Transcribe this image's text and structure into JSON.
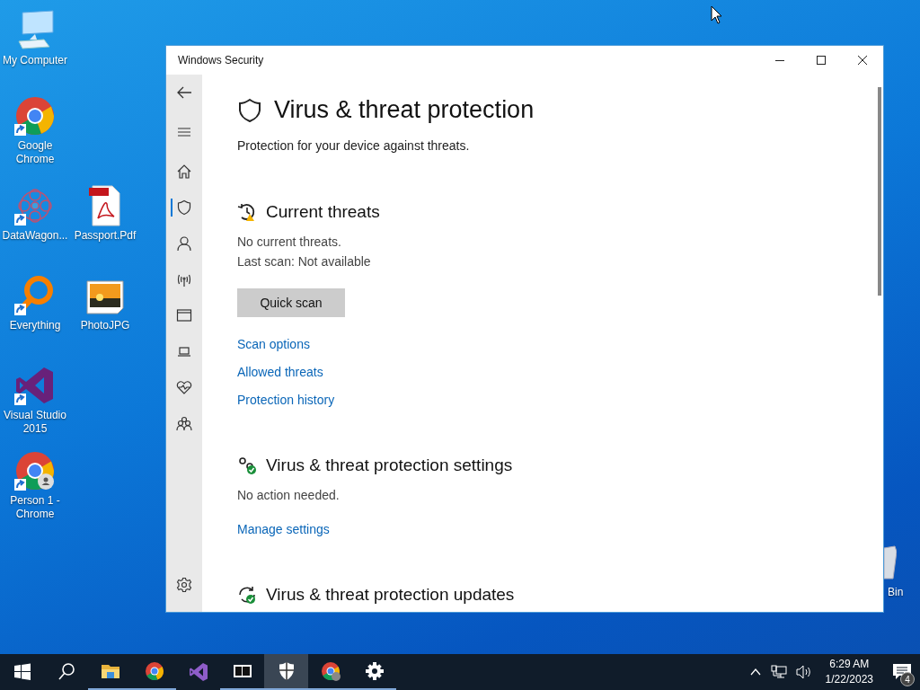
{
  "desktop": {
    "icons": [
      {
        "kind": "computer",
        "label": "My Computer",
        "shortcut": false
      },
      {
        "kind": "chrome",
        "label": "Google Chrome",
        "shortcut": true
      },
      {
        "kind": "datawagon",
        "label": "DataWagon...",
        "shortcut": true
      },
      {
        "kind": "pdf",
        "label": "Passport.Pdf",
        "shortcut": false
      },
      {
        "kind": "everything",
        "label": "Everything",
        "shortcut": true
      },
      {
        "kind": "photo",
        "label": "PhotoJPG",
        "shortcut": false
      },
      {
        "kind": "vs",
        "label": "Visual Studio 2015",
        "shortcut": true
      },
      {
        "kind": "chrome-person",
        "label": "Person 1 - Chrome",
        "shortcut": true
      },
      {
        "kind": "bin",
        "label": "Bin"
      }
    ]
  },
  "window": {
    "title": "Windows Security",
    "nav": [
      {
        "kind": "home",
        "selected": false
      },
      {
        "kind": "shield",
        "selected": true
      },
      {
        "kind": "account",
        "selected": false
      },
      {
        "kind": "network",
        "selected": false
      },
      {
        "kind": "app",
        "selected": false
      },
      {
        "kind": "device",
        "selected": false
      },
      {
        "kind": "health",
        "selected": false
      },
      {
        "kind": "family",
        "selected": false
      }
    ],
    "page": {
      "title": "Virus & threat protection",
      "subtitle": "Protection for your device against threats.",
      "sections": [
        {
          "kind": "threats",
          "title": "Current threats",
          "lines": [
            "No current threats.",
            "Last scan: Not available"
          ],
          "button": "Quick scan",
          "links": [
            "Scan options",
            "Allowed threats",
            "Protection history"
          ]
        },
        {
          "kind": "settings",
          "title": "Virus & threat protection settings",
          "lines": [
            "No action needed."
          ],
          "links": [
            "Manage settings"
          ]
        },
        {
          "kind": "updates",
          "title": "Virus & threat protection updates"
        }
      ]
    }
  },
  "taskbar": {
    "items": [
      {
        "kind": "start",
        "running": false,
        "selected": false
      },
      {
        "kind": "search",
        "running": false,
        "selected": false
      },
      {
        "kind": "explorer",
        "running": true,
        "selected": false
      },
      {
        "kind": "chrome",
        "running": true,
        "selected": false
      },
      {
        "kind": "vs",
        "running": false,
        "selected": false
      },
      {
        "kind": "sevenzip",
        "running": true,
        "selected": false
      },
      {
        "kind": "security",
        "running": true,
        "selected": true
      },
      {
        "kind": "chrome-person",
        "running": true,
        "selected": false
      },
      {
        "kind": "settings",
        "running": true,
        "selected": false
      }
    ],
    "tray": {
      "time": "6:29 AM",
      "date": "1/22/2023",
      "notifications": "4"
    }
  }
}
